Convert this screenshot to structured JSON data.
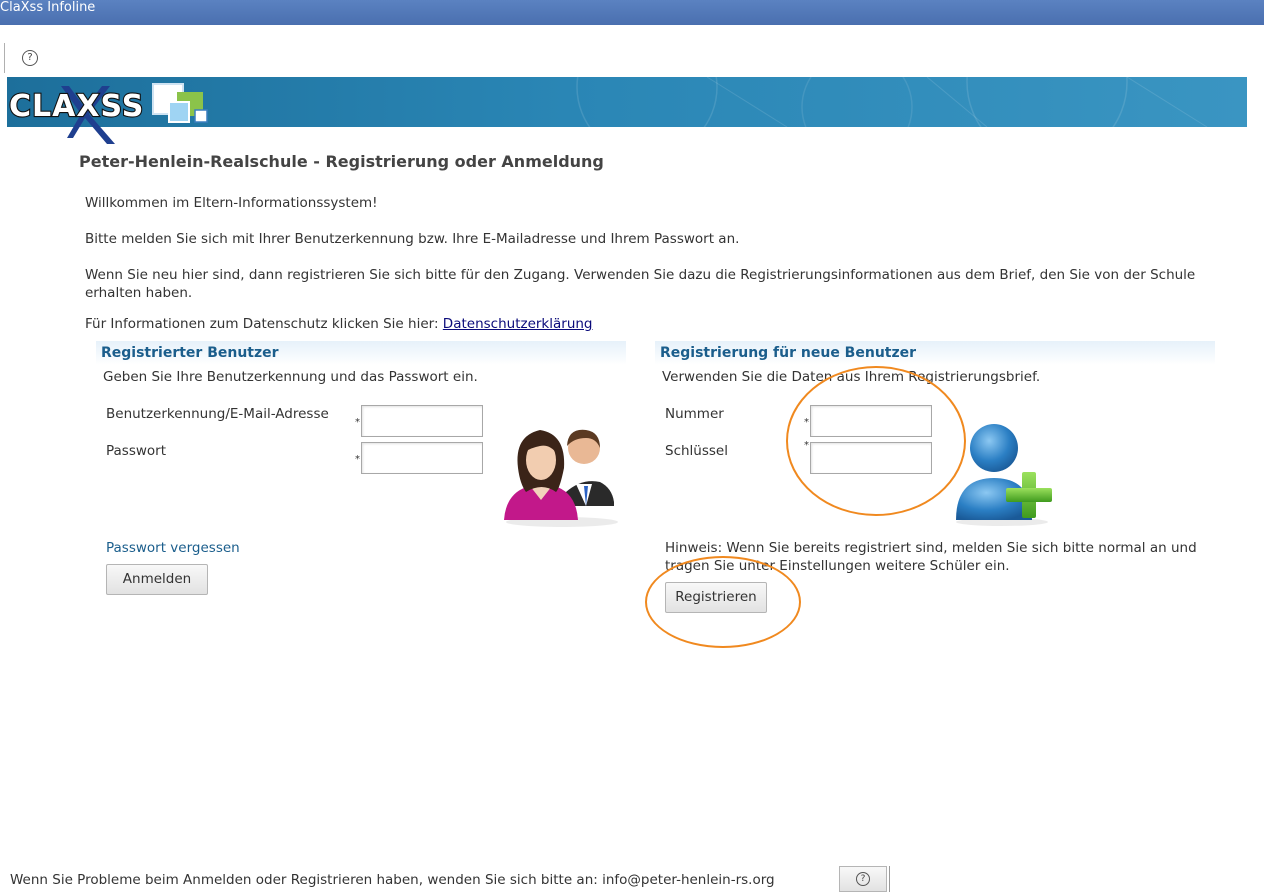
{
  "window": {
    "title": "ClaXss Infoline"
  },
  "banner": {
    "logo_text": "CLAXSS"
  },
  "page": {
    "title": "Peter-Henlein-Realschule - Registrierung oder Anmeldung",
    "welcome": "Willkommen im Eltern-Informationssystem!",
    "login_hint": "Bitte melden Sie sich mit Ihrer Benutzerkennung bzw. Ihre E-Mailadresse und Ihrem Passwort an.",
    "register_hint": "Wenn Sie neu hier sind, dann registrieren Sie sich bitte für den Zugang. Verwenden Sie dazu die Registrierungsinformationen aus dem Brief, den Sie von der Schule erhalten haben.",
    "privacy_prefix": "Für Informationen zum Datenschutz klicken Sie hier: ",
    "privacy_link": "Datenschutzerklärung"
  },
  "login": {
    "header": "Registrierter Benutzer",
    "instruction": "Geben Sie Ihre Benutzerkennung und das Passwort ein.",
    "username_label": "Benutzerkennung/E-Mail-Adresse",
    "username_value": "",
    "password_label": "Passwort",
    "password_value": "",
    "required_marker": "*",
    "forgot_link": "Passwort vergessen",
    "submit_label": "Anmelden"
  },
  "register": {
    "header": "Registrierung für neue Benutzer",
    "instruction": "Verwenden Sie die Daten aus Ihrem Registrierungsbrief.",
    "number_label": "Nummer",
    "number_value": "",
    "key_label": "Schlüssel",
    "key_value": "",
    "required_marker": "*",
    "note": "Hinweis: Wenn Sie bereits registriert sind, melden Sie sich bitte normal an und tragen Sie unter Einstellungen weitere Schüler ein.",
    "submit_label": "Registrieren"
  },
  "footer": {
    "text": "Wenn Sie Probleme beim Anmelden oder Registrieren haben, wenden Sie sich bitte an: info@peter-henlein-rs.org",
    "help_icon": "question-circle-icon",
    "help_glyph": "?"
  },
  "colors": {
    "accent": "#1b5e8c",
    "banner": "#2a86b5",
    "highlight": "#f0891f"
  },
  "icons": {
    "top_help": "question-circle-icon",
    "users": "users-icon",
    "add_user": "add-user-icon"
  }
}
